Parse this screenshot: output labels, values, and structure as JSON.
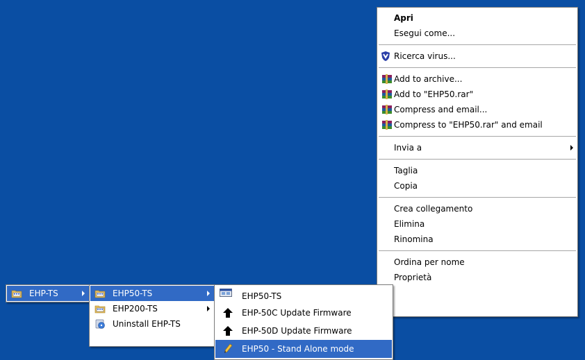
{
  "context_menu": {
    "items": [
      {
        "label": "Apri",
        "bold": true
      },
      {
        "label": "Esegui come..."
      },
      {
        "sep": true
      },
      {
        "label": "Ricerca virus...",
        "icon": "antivirus-shield-icon"
      },
      {
        "sep": true
      },
      {
        "label": "Add to archive...",
        "icon": "winrar-icon"
      },
      {
        "label": "Add to \"EHP50.rar\"",
        "icon": "winrar-icon"
      },
      {
        "label": "Compress and email...",
        "icon": "winrar-icon"
      },
      {
        "label": "Compress to \"EHP50.rar\" and email",
        "icon": "winrar-icon"
      },
      {
        "sep": true
      },
      {
        "label": "Invia a",
        "submenu": true
      },
      {
        "sep": true
      },
      {
        "label": "Taglia"
      },
      {
        "label": "Copia"
      },
      {
        "sep": true
      },
      {
        "label": "Crea collegamento"
      },
      {
        "label": "Elimina"
      },
      {
        "label": "Rinomina"
      },
      {
        "sep": true
      },
      {
        "label": "Ordina per nome"
      },
      {
        "label": "Proprietà"
      }
    ]
  },
  "start_menu": {
    "level1": [
      {
        "label": "EHP-TS",
        "icon": "program-group-folder-icon",
        "highlighted": true
      }
    ],
    "level2": [
      {
        "label": "EHP50-TS",
        "icon": "program-group-folder-icon",
        "highlighted": true
      },
      {
        "label": "EHP200-TS",
        "icon": "program-group-folder-icon"
      },
      {
        "label": "Uninstall EHP-TS",
        "icon": "uninstall-icon"
      }
    ],
    "level3": [
      {
        "label": "EHP50-TS",
        "icon": "application-window-icon"
      },
      {
        "label": "EHP-50C Update Firmware",
        "icon": "shortcut-arrow-icon"
      },
      {
        "label": "EHP-50D Update Firmware",
        "icon": "shortcut-arrow-icon"
      },
      {
        "label": "EHP50 - Stand Alone mode",
        "icon": "pencil-icon",
        "highlighted": true
      }
    ]
  },
  "colors": {
    "desktop": "#0a4ea3",
    "highlight": "#316ac5"
  }
}
